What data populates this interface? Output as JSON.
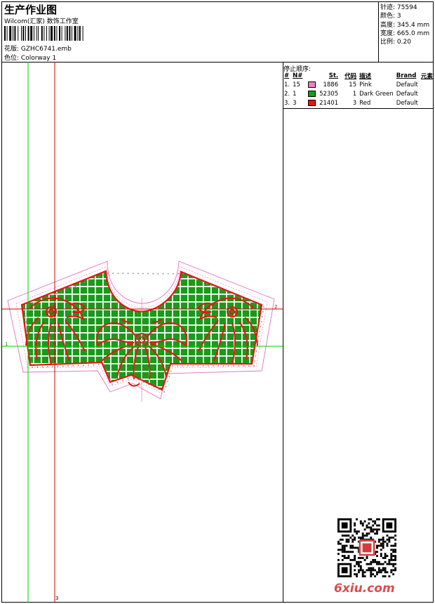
{
  "header": {
    "title": "生产作业图",
    "studio": "Wilcom(汇家) 数饰工作室",
    "design_label": "花版:",
    "design_file": "GZHC6741.emb",
    "colorway_label": "色位:",
    "colorway": "Colorway 1"
  },
  "stats": [
    {
      "label": "针迹:",
      "value": "75594"
    },
    {
      "label": "颜色:",
      "value": "3"
    },
    {
      "label": "高度:",
      "value": "345.4 mm"
    },
    {
      "label": "宽度:",
      "value": "665.0 mm"
    },
    {
      "label": "比例:",
      "value": "0.20"
    }
  ],
  "stop_sequence": {
    "title": "停止顺序:",
    "headers": [
      "#",
      "N#",
      "St.",
      "代码",
      "描述",
      "Brand",
      "元素"
    ],
    "rows": [
      {
        "num": "1.",
        "n": "15",
        "color": "#f080c0",
        "stitches": "1886",
        "code": "15",
        "desc": "Pink",
        "brand": "Default"
      },
      {
        "num": "2.",
        "n": "1",
        "color": "#1a9a1a",
        "stitches": "52305",
        "code": "1",
        "desc": "Dark Green",
        "brand": "Default"
      },
      {
        "num": "3.",
        "n": "3",
        "color": "#ee1111",
        "stitches": "21401",
        "code": "3",
        "desc": "Red",
        "brand": "Default"
      }
    ]
  },
  "canvas": {
    "axis_left_label": "1",
    "axis_right_label": "2",
    "axis_bottom_label": "3",
    "colors": {
      "green": "#1a9a1a",
      "red": "#ee1111",
      "pink": "#e66fc4",
      "guide_green": "#00cc00",
      "guide_red": "#cc0000"
    }
  },
  "watermark": {
    "text": "6xiu.com"
  }
}
